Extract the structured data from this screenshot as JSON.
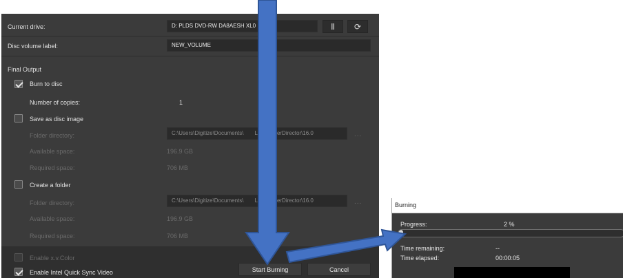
{
  "drive": {
    "label": "Current drive:",
    "value": "D: PLDS DVD-RW DA8AESH XL0",
    "eject_icon": "eject-icon",
    "refresh_icon": "refresh-icon"
  },
  "volume": {
    "label": "Disc volume label:",
    "value": "NEW_VOLUME"
  },
  "final_output": {
    "heading": "Final Output",
    "burn_to_disc": {
      "label": "Burn to disc",
      "checked": true
    },
    "copies": {
      "label": "Number of copies:",
      "value": "1"
    },
    "save_as_image": {
      "label": "Save as disc image",
      "checked": false,
      "folder_label": "Folder directory:",
      "folder_value": "C:\\Users\\Digitize\\Documents\\",
      "folder_value_tail": "Link\\PowerDirector\\16.0",
      "browse": "...",
      "available_label": "Available space:",
      "available_value": "196.9 GB",
      "required_label": "Required space:",
      "required_value": "706 MB"
    },
    "create_folder": {
      "label": "Create a folder",
      "checked": false,
      "folder_label": "Folder directory:",
      "folder_value": "C:\\Users\\Digitize\\Documents\\",
      "folder_value_tail": "Link\\PowerDirector\\16.0",
      "browse": "...",
      "available_label": "Available space:",
      "available_value": "196.9 GB",
      "required_label": "Required space:",
      "required_value": "706 MB"
    }
  },
  "bottom": {
    "xvcolor": {
      "label": "Enable x.v.Color",
      "checked": false
    },
    "quicksync": {
      "label": "Enable Intel Quick Sync Video",
      "checked": true
    },
    "start_label": "Start Burning",
    "cancel_label": "Cancel"
  },
  "burning": {
    "title": "Burning",
    "progress_label": "Progress:",
    "progress_text": "2 %",
    "progress_fraction": 0.02,
    "remaining_label": "Time remaining:",
    "remaining_value": "--",
    "elapsed_label": "Time elapsed:",
    "elapsed_value": "00:00:05"
  },
  "colors": {
    "arrow": "#4472c4",
    "panel": "#3b3b3b"
  }
}
